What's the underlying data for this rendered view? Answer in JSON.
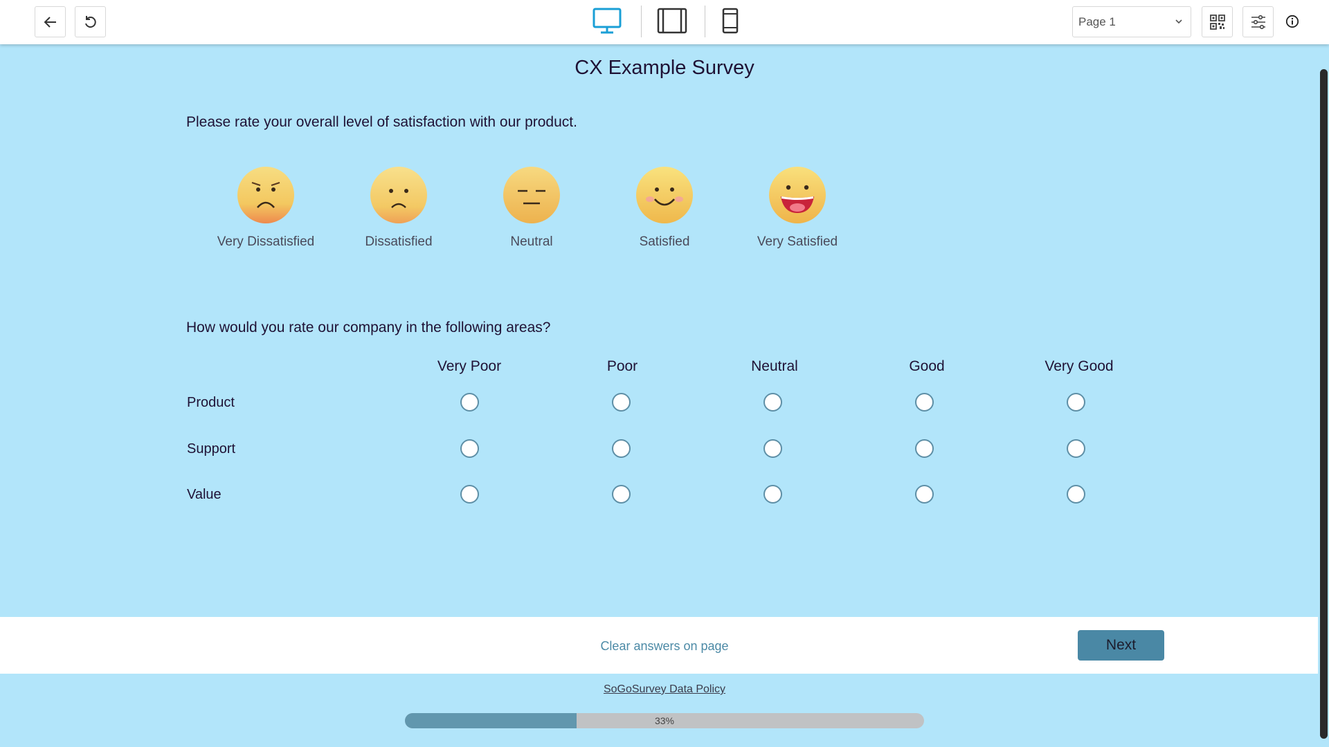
{
  "toolbar": {
    "back_icon": "arrow-left-icon",
    "reset_icon": "refresh-icon",
    "devices": [
      "desktop-icon",
      "tablet-icon",
      "mobile-icon"
    ],
    "page_selector": "Page 1",
    "qr_icon": "qr-code-icon",
    "settings_icon": "sliders-icon",
    "info_icon": "info-icon",
    "accent_color": "#1a9fd6"
  },
  "survey": {
    "title": "CX Example Survey",
    "q1": {
      "text": "Please rate your overall level of satisfaction with our product.",
      "options": [
        "Very Dissatisfied",
        "Dissatisfied",
        "Neutral",
        "Satisfied",
        "Very Satisfied"
      ]
    },
    "q2": {
      "text": "How would you rate our company in the following areas?",
      "columns": [
        "Very Poor",
        "Poor",
        "Neutral",
        "Good",
        "Very Good"
      ],
      "rows": [
        "Product",
        "Support",
        "Value"
      ]
    }
  },
  "footer": {
    "clear_label": "Clear answers on page",
    "next_label": "Next",
    "policy_label": "SoGoSurvey Data Policy",
    "progress_percent": 33,
    "progress_label": "33%"
  },
  "colors": {
    "background": "#b2e5fa",
    "button": "#4a88a5",
    "progress_fill": "#6197ae"
  }
}
